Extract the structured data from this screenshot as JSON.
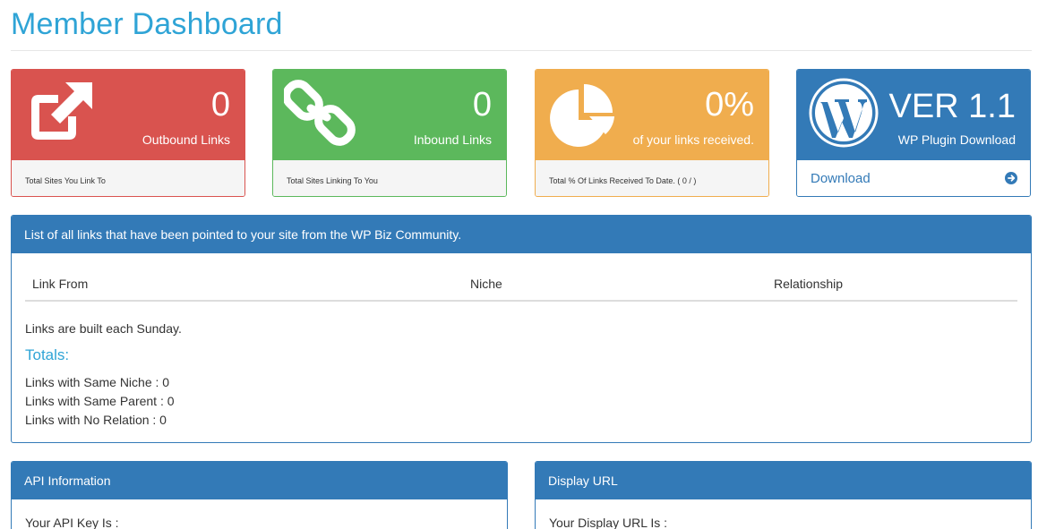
{
  "page": {
    "title": "Member Dashboard"
  },
  "cards": {
    "outbound": {
      "value": "0",
      "label": "Outbound Links",
      "footer": "Total Sites You Link To",
      "icon": "external-link-icon",
      "color": "#d9534f"
    },
    "inbound": {
      "value": "0",
      "label": "Inbound Links",
      "footer": "Total Sites Linking To You",
      "icon": "chain-link-icon",
      "color": "#5cb85c"
    },
    "received": {
      "value": "0%",
      "label": "of your links received.",
      "footer": "Total % Of Links Received To Date. ( 0 / )",
      "icon": "pie-chart-icon",
      "color": "#f0ad4e"
    },
    "plugin": {
      "value": "VER 1.1",
      "label": "WP Plugin Download",
      "link": "Download",
      "icon": "wordpress-icon",
      "arrow_icon": "circle-arrow-right-icon",
      "color": "#337ab7"
    }
  },
  "links_panel": {
    "heading": "List of all links that have been pointed to your site from the WP Biz Community.",
    "columns": [
      "Link From",
      "Niche",
      "Relationship"
    ],
    "note": "Links are built each Sunday.",
    "totals_title": "Totals:",
    "stats": [
      "Links with Same Niche : 0",
      "Links with Same Parent : 0",
      "Links with No Relation : 0"
    ]
  },
  "api_panel": {
    "heading": "API Information",
    "body": "Your API Key Is :"
  },
  "url_panel": {
    "heading": "Display URL",
    "body": "Your Display URL Is :"
  },
  "colors": {
    "title": "#2fa4d6",
    "primary": "#337ab7",
    "danger": "#d9534f",
    "success": "#5cb85c",
    "warning": "#f0ad4e"
  }
}
